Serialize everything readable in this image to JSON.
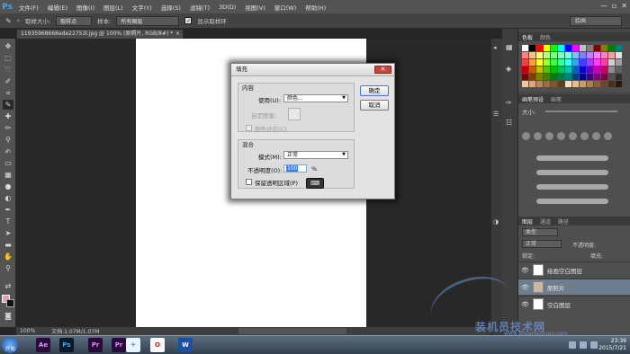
{
  "menubar": {
    "logo": "Ps",
    "items": [
      "文件(F)",
      "编辑(E)",
      "图像(I)",
      "图层(L)",
      "文字(Y)",
      "选择(S)",
      "滤镜(T)",
      "3D(D)",
      "视图(V)",
      "窗口(W)",
      "帮助(H)"
    ],
    "win_controls": [
      "—",
      "▫",
      "✕"
    ]
  },
  "options": {
    "sample_size_label": "取样大小:",
    "sample_size_value": "取样点",
    "sample_label": "样本:",
    "sample_value": "所有图层",
    "show_ring_label": "显示取样环",
    "show_ring_checked": true,
    "workspace": "绘画"
  },
  "document_tab": {
    "title": "11935968666ede22753l.jpg @ 100% (原照片, RGB/8#) *",
    "close": "×"
  },
  "status": {
    "zoom": "100%",
    "doc_info": "文档:1.07M/1.07M"
  },
  "fill_dialog": {
    "title": "填充",
    "close": "✕",
    "content_group": "内容",
    "use_label": "使用(U):",
    "use_value": "颜色...",
    "custom_pattern_label": "自定图案:",
    "color_adaptation_label": "颜色适应(C)",
    "blend_group": "混合",
    "mode_label": "模式(M):",
    "mode_value": "正常",
    "opacity_label": "不透明度(O):",
    "opacity_value": "100",
    "opacity_unit": "%",
    "preserve_transparency_label": "保留透明区域(P)",
    "ok_label": "确定",
    "cancel_label": "取消"
  },
  "panels": {
    "color_tabs": [
      "色板",
      "颜色"
    ],
    "brush_tabs": [
      "画笔预设",
      "画笔"
    ],
    "brush_size_label": "大小:",
    "layers_tabs": [
      "图层",
      "通道",
      "路径"
    ],
    "layer_kind_label": "类型",
    "blend_mode": "正常",
    "opacity_label": "不透明度:",
    "lock_label": "锁定:",
    "fill_label": "填充:",
    "layers": [
      {
        "name": "绘画空白图层",
        "selected": false
      },
      {
        "name": "原照片",
        "selected": true
      },
      {
        "name": "空白图层",
        "selected": false
      }
    ]
  },
  "swatch_colors": [
    "#ffffff",
    "#000000",
    "#ff0000",
    "#ffff00",
    "#00ff00",
    "#00ffff",
    "#0000ff",
    "#ff00ff",
    "#c0c0c0",
    "#808080",
    "#800000",
    "#808000",
    "#008000",
    "#008080",
    "#ff8080",
    "#ffbf80",
    "#ffff80",
    "#bfff80",
    "#80ff80",
    "#80ffbf",
    "#80ffff",
    "#80bfff",
    "#8080ff",
    "#bf80ff",
    "#ff80ff",
    "#ff80bf",
    "#ffa0a0",
    "#e0e0e0",
    "#ff4040",
    "#ff9f40",
    "#ffff40",
    "#9fff40",
    "#40ff40",
    "#40ff9f",
    "#40ffff",
    "#409fff",
    "#4040ff",
    "#9f40ff",
    "#ff40ff",
    "#ff409f",
    "#d0d0d0",
    "#a0a0a0",
    "#c00000",
    "#c06000",
    "#c0c000",
    "#60c000",
    "#00c000",
    "#00c060",
    "#00c0c0",
    "#0060c0",
    "#0000c0",
    "#6000c0",
    "#c000c0",
    "#c00060",
    "#909090",
    "#606060",
    "#800000",
    "#804000",
    "#808000",
    "#408000",
    "#008000",
    "#008040",
    "#008080",
    "#004080",
    "#000080",
    "#400080",
    "#800080",
    "#800040",
    "#505050",
    "#303030",
    "#f0c8a0",
    "#d8a878",
    "#b88858",
    "#987040",
    "#785830",
    "#584020",
    "#f8e0c0",
    "#e0c090",
    "#c8a070",
    "#a88050",
    "#886040",
    "#684830",
    "#483020",
    "#281810"
  ],
  "taskbar": {
    "start_label": "开始",
    "apps": [
      {
        "label": "Ae",
        "bg": "#2a0a3a",
        "fg": "#d49cff"
      },
      {
        "label": "Ps",
        "bg": "#0a1a2a",
        "fg": "#31a8ff"
      },
      {
        "label": "Pr",
        "bg": "#2a0a3a",
        "fg": "#e08cff"
      },
      {
        "label": "Pr",
        "bg": "#2a0a3a",
        "fg": "#e08cff"
      },
      {
        "label": "✈",
        "bg": "#e8f4ff",
        "fg": "#2a7fd4"
      },
      {
        "label": "O",
        "bg": "#ffffff",
        "fg": "#e01010"
      },
      {
        "label": "W",
        "bg": "#1c4fa0",
        "fg": "#ffffff"
      }
    ],
    "time": "23:39",
    "date": "2015/7/21"
  },
  "watermark": {
    "text": "装机员技术网",
    "url": "www.zhuangjiyuan.com"
  }
}
